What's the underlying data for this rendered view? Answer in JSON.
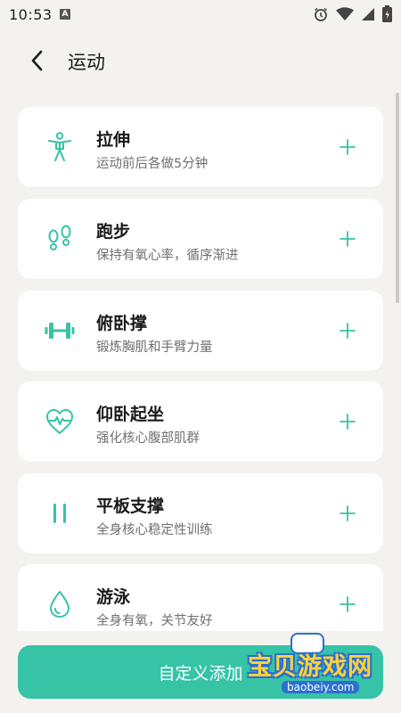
{
  "status_bar": {
    "time": "10:53",
    "notification_letter": "A"
  },
  "header": {
    "title": "运动",
    "back_icon": "chevron-left-icon"
  },
  "colors": {
    "accent": "#36c3a6",
    "background": "#f3f2ef",
    "card": "#ffffff"
  },
  "exercises": [
    {
      "title": "拉伸",
      "subtitle": "运动前后各做5分钟",
      "icon": "stretch-person-icon"
    },
    {
      "title": "跑步",
      "subtitle": "保持有氧心率，循序渐进",
      "icon": "footprints-icon"
    },
    {
      "title": "俯卧撑",
      "subtitle": "锻炼胸肌和手臂力量",
      "icon": "dumbbell-icon"
    },
    {
      "title": "仰卧起坐",
      "subtitle": "强化核心腹部肌群",
      "icon": "heart-pulse-icon"
    },
    {
      "title": "平板支撑",
      "subtitle": "全身核心稳定性训练",
      "icon": "pause-bars-icon"
    },
    {
      "title": "游泳",
      "subtitle": "全身有氧，关节友好",
      "icon": "water-drop-icon"
    }
  ],
  "add_button": {
    "label": "自定义添加"
  },
  "watermark": {
    "name": "宝贝游戏网",
    "url": "baobeiy.com"
  }
}
